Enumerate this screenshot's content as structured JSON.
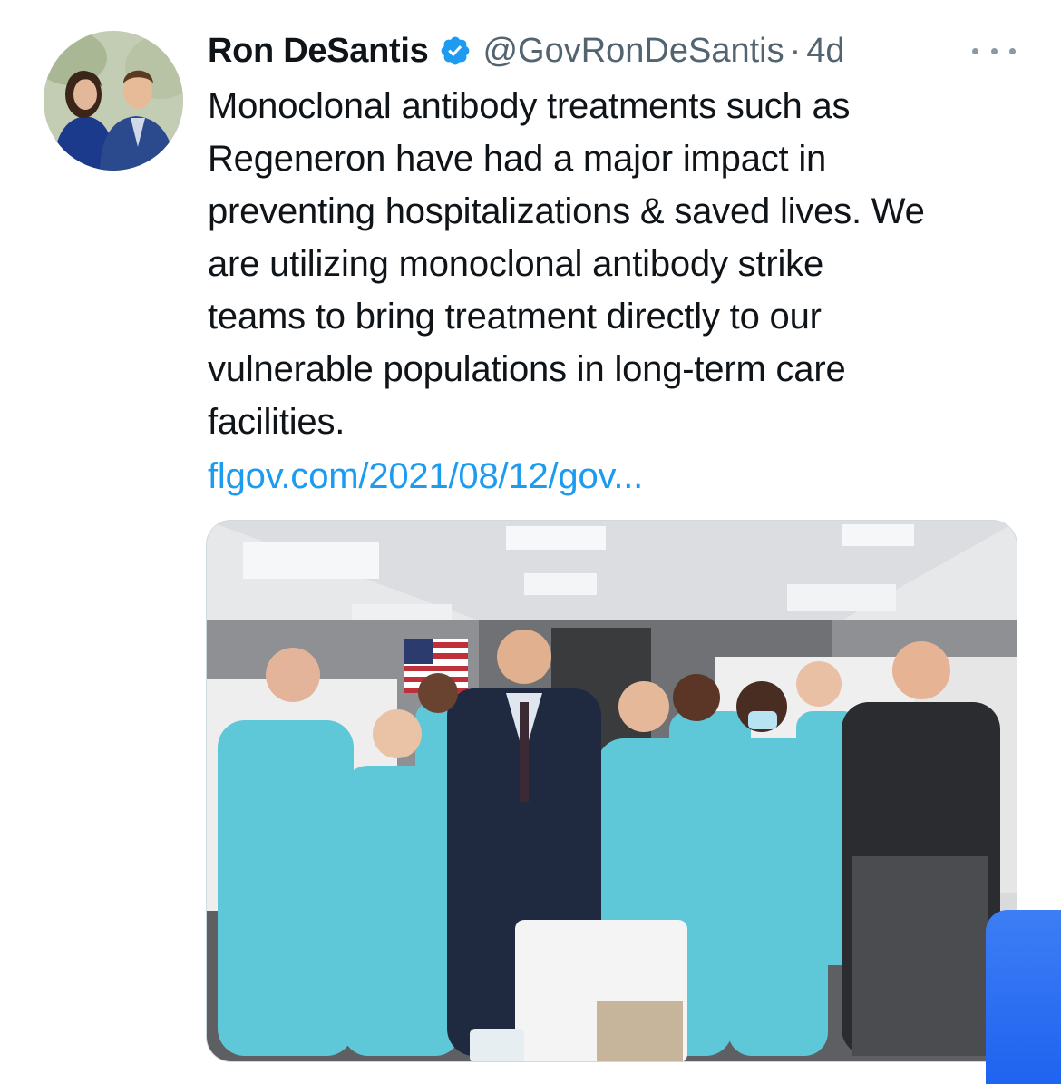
{
  "tweet": {
    "author_name": "Ron DeSantis",
    "handle": "@GovRonDeSantis",
    "separator": "·",
    "timestamp": "4d",
    "text": "Monoclonal antibody treatments such as\nRegeneron have had a major impact in\npreventing hospitalizations & saved lives. We\nare utilizing monoclonal antibody strike\nteams to bring treatment directly to our\nvulnerable populations in long-term care\nfacilities.",
    "link_text": "flgov.com/2021/08/12/gov..."
  },
  "icons": {
    "verified": "verified-badge-icon",
    "more": "more-options-icon"
  },
  "colors": {
    "link": "#1d9bf0",
    "secondary_text": "#536471",
    "verified_badge": "#1d9bf0",
    "overlay_blue": "#2a6ef2"
  }
}
